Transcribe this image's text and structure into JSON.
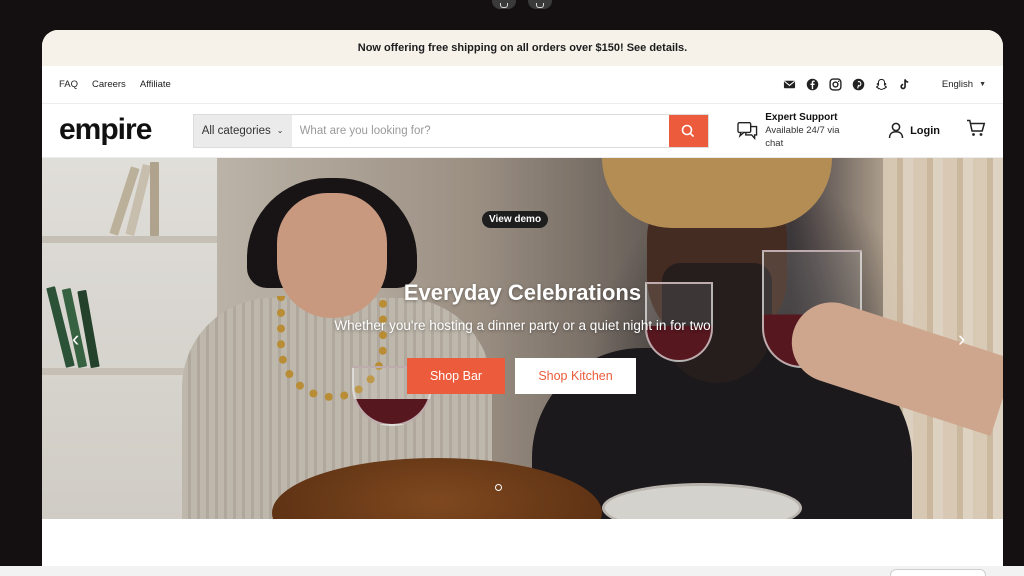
{
  "announcement": "Now offering free shipping on all orders over $150! See details.",
  "utility": {
    "links": [
      "FAQ",
      "Careers",
      "Affiliate"
    ],
    "social_icons": [
      "email-icon",
      "facebook-icon",
      "instagram-icon",
      "pinterest-icon",
      "snapchat-icon",
      "tiktok-icon"
    ],
    "language": "English"
  },
  "header": {
    "logo": "empire",
    "search": {
      "category": "All categories",
      "placeholder": "What are you looking for?"
    },
    "support": {
      "title": "Expert Support",
      "subtitle": "Available 24/7 via chat"
    },
    "login": "Login"
  },
  "hero": {
    "badge": "View demo",
    "title": "Everyday Celebrations",
    "subtitle": "Whether you're hosting a dinner party or a quiet night in for two",
    "primary_button": "Shop Bar",
    "secondary_button": "Shop Kitchen",
    "prev_arrow": "‹",
    "next_arrow": "›"
  },
  "colors": {
    "accent": "#ec5b3c",
    "announcement_bg": "#f6f2ea",
    "page_bg": "#141012"
  }
}
